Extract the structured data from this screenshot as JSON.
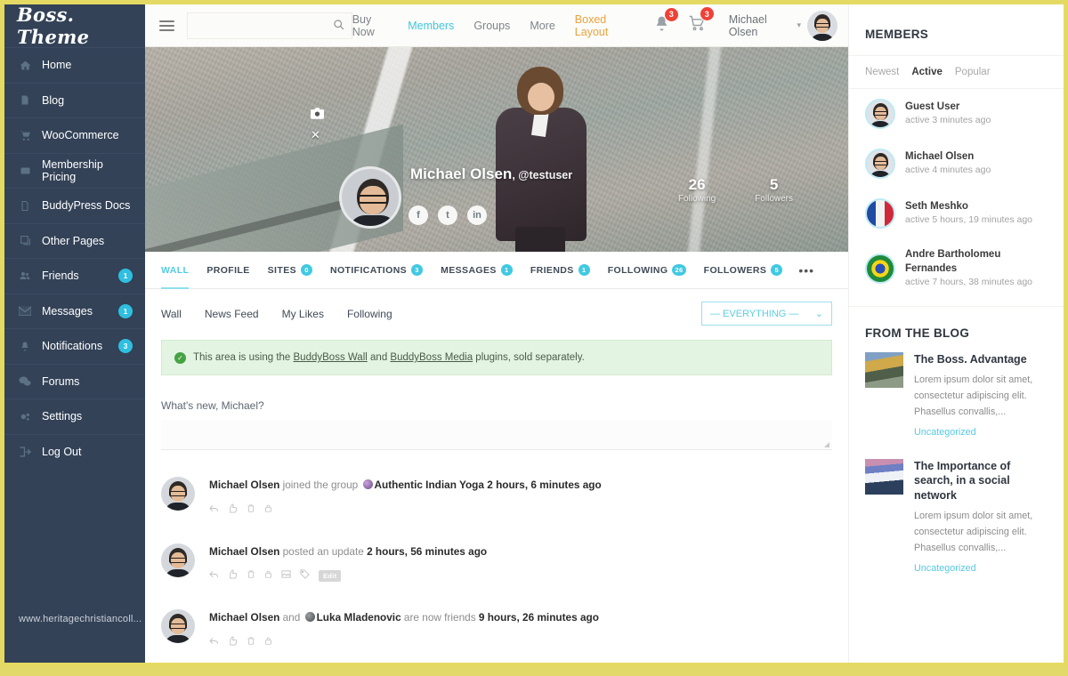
{
  "brand": {
    "name": "Boss. Theme"
  },
  "sidebar": {
    "items": [
      {
        "label": "Home",
        "icon": "home-icon",
        "badge": null
      },
      {
        "label": "Blog",
        "icon": "document-icon",
        "badge": null
      },
      {
        "label": "WooCommerce",
        "icon": "cart-icon",
        "badge": null
      },
      {
        "label": "Membership Pricing",
        "icon": "card-icon",
        "badge": null
      },
      {
        "label": "BuddyPress Docs",
        "icon": "page-icon",
        "badge": null
      },
      {
        "label": "Other Pages",
        "icon": "pages-icon",
        "badge": null
      },
      {
        "label": "Friends",
        "icon": "friends-icon",
        "badge": "1"
      },
      {
        "label": "Messages",
        "icon": "envelope-icon",
        "badge": "1"
      },
      {
        "label": "Notifications",
        "icon": "bell-icon",
        "badge": "3"
      },
      {
        "label": "Forums",
        "icon": "chat-icon",
        "badge": null
      },
      {
        "label": "Settings",
        "icon": "gear-icon",
        "badge": null
      },
      {
        "label": "Log Out",
        "icon": "logout-icon",
        "badge": null
      }
    ],
    "watermark": "www.heritagechristiancoll..."
  },
  "topbar": {
    "search_placeholder": "",
    "search_value": "",
    "nav": [
      {
        "label": "Buy Now",
        "state": "normal"
      },
      {
        "label": "Members",
        "state": "active"
      },
      {
        "label": "Groups",
        "state": "normal"
      },
      {
        "label": "More",
        "state": "normal"
      },
      {
        "label": "Boxed Layout",
        "state": "accent"
      }
    ],
    "bell_badge": "3",
    "cart_badge": "3",
    "user_name": "Michael Olsen"
  },
  "cover": {
    "display_name": "Michael Olsen",
    "handle": ", @testuser",
    "social": [
      {
        "name": "facebook-icon",
        "glyph": "f"
      },
      {
        "name": "twitter-icon",
        "glyph": "t"
      },
      {
        "name": "linkedin-icon",
        "glyph": "in"
      }
    ],
    "stats": [
      {
        "value": "26",
        "label": "Following"
      },
      {
        "value": "5",
        "label": "Followers"
      }
    ]
  },
  "tabs": [
    {
      "label": "WALL",
      "badge": null,
      "active": true
    },
    {
      "label": "PROFILE",
      "badge": null,
      "active": false
    },
    {
      "label": "SITES",
      "badge": "0",
      "active": false
    },
    {
      "label": "NOTIFICATIONS",
      "badge": "3",
      "active": false
    },
    {
      "label": "MESSAGES",
      "badge": "1",
      "active": false
    },
    {
      "label": "FRIENDS",
      "badge": "1",
      "active": false
    },
    {
      "label": "FOLLOWING",
      "badge": "26",
      "active": false
    },
    {
      "label": "FOLLOWERS",
      "badge": "5",
      "active": false
    }
  ],
  "tab_more": "•••",
  "subnav": [
    {
      "label": "Wall"
    },
    {
      "label": "News Feed"
    },
    {
      "label": "My Likes"
    },
    {
      "label": "Following"
    }
  ],
  "filter": {
    "value": "— EVERYTHING —",
    "caret": "⌄"
  },
  "notice": {
    "text_before": "This area is using the ",
    "link1": "BuddyBoss Wall",
    "text_mid": " and ",
    "link2": "BuddyBoss Media",
    "text_after": " plugins, sold separately."
  },
  "composer": {
    "label": "What's new, Michael?",
    "value": ""
  },
  "feed": [
    {
      "author": "Michael Olsen",
      "action": " joined the group ",
      "group": "Authentic Indian Yoga",
      "time": " 2 hours, 6 minutes ago",
      "has_group_icon": true,
      "group_icon_dark": false,
      "actions": [
        "reply-icon",
        "like-icon",
        "delete-icon",
        "lock-icon"
      ]
    },
    {
      "author": "Michael Olsen",
      "action": " posted an update ",
      "group": "",
      "time": "2 hours, 56 minutes ago",
      "has_group_icon": false,
      "group_icon_dark": false,
      "actions": [
        "reply-icon",
        "like-icon",
        "delete-icon",
        "lock-icon",
        "image-icon",
        "tag-icon"
      ],
      "edit_label": "Edit"
    },
    {
      "author": "Michael Olsen",
      "action": " and ",
      "group": "Luka Mladenovic",
      "action2": " are now friends ",
      "time": "9 hours, 26 minutes ago",
      "has_group_icon": true,
      "group_icon_dark": true,
      "actions": [
        "reply-icon",
        "like-icon",
        "delete-icon",
        "lock-icon"
      ]
    }
  ],
  "members_panel": {
    "title": "MEMBERS",
    "filters": [
      {
        "label": "Newest",
        "active": false
      },
      {
        "label": "Active",
        "active": true
      },
      {
        "label": "Popular",
        "active": false
      }
    ],
    "items": [
      {
        "name": "Guest User",
        "time": "active 3 minutes ago",
        "avatar": "photo"
      },
      {
        "name": "Michael Olsen",
        "time": "active 4 minutes ago",
        "avatar": "photo"
      },
      {
        "name": "Seth Meshko",
        "time": "active 5 hours, 19 minutes ago",
        "avatar": "flagfr"
      },
      {
        "name": "Andre Bartholomeu Fernandes",
        "time": "active 7 hours, 38 minutes ago",
        "avatar": "flagbr"
      }
    ]
  },
  "blog_panel": {
    "title": "FROM THE BLOG",
    "posts": [
      {
        "title": "The Boss. Advantage",
        "excerpt": "Lorem ipsum dolor sit amet, consectetur adipiscing elit. Phasellus convallis,...",
        "category": "Uncategorized",
        "thumb": "road"
      },
      {
        "title": "The Importance of search, in a social network",
        "excerpt": "Lorem ipsum dolor sit amet, consectetur adipiscing elit. Phasellus convallis,...",
        "category": "Uncategorized",
        "thumb": "lake"
      }
    ]
  },
  "colors": {
    "sidebar_bg": "#334257",
    "accent_cyan": "#41c9e2",
    "accent_orange": "#e8a33d",
    "badge_red": "#ef4136",
    "frame": "#e4da63"
  }
}
